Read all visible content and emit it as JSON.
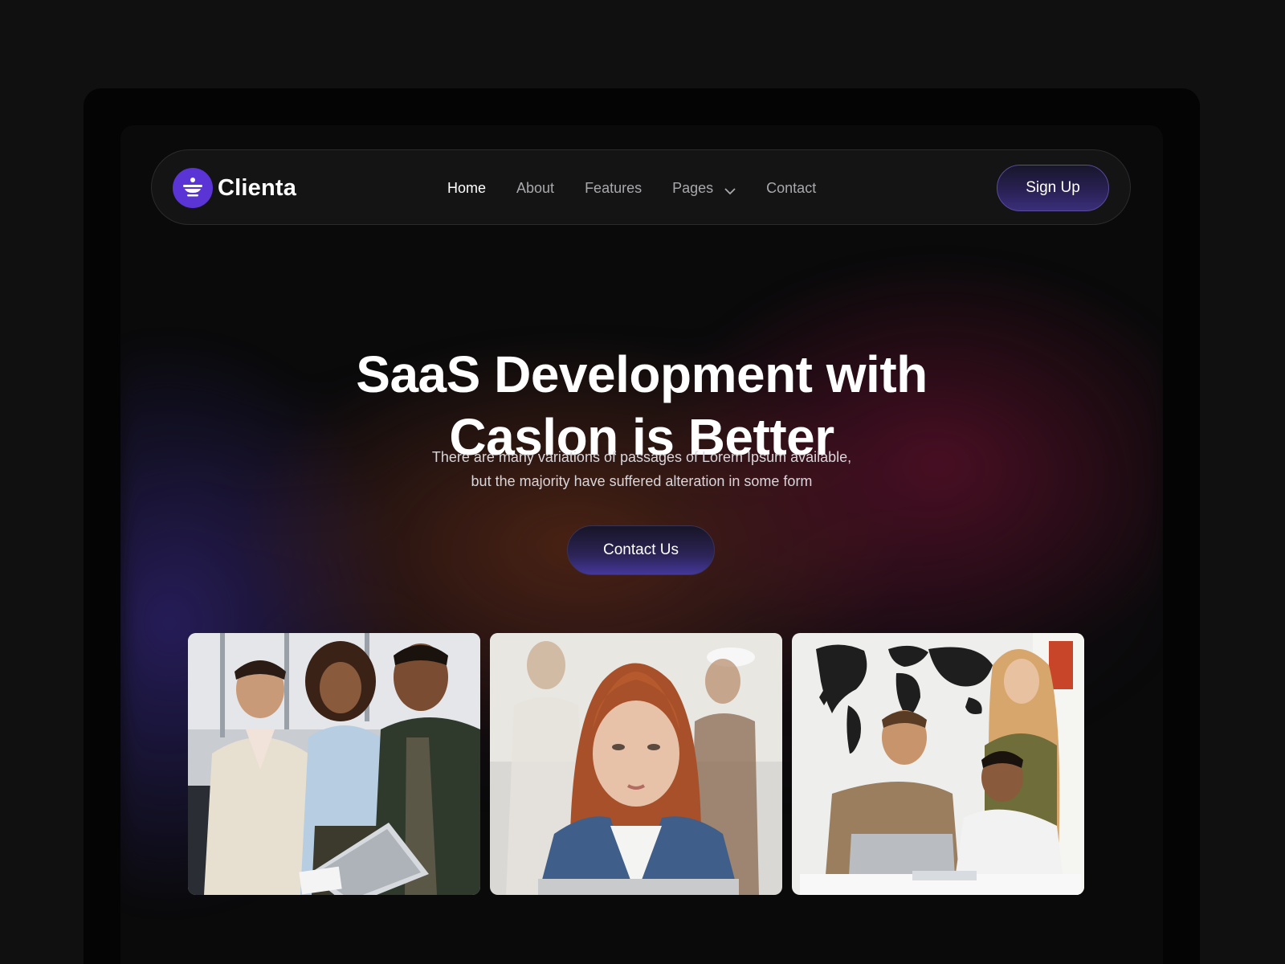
{
  "brand": {
    "name": "Clienta",
    "icon": "logo-icon",
    "accent_color": "#5b34d6"
  },
  "nav": {
    "items": [
      {
        "label": "Home",
        "active": true
      },
      {
        "label": "About",
        "active": false
      },
      {
        "label": "Features",
        "active": false
      },
      {
        "label": "Pages",
        "active": false,
        "has_dropdown": true
      },
      {
        "label": "Contact",
        "active": false
      }
    ],
    "signup_label": "Sign Up"
  },
  "hero": {
    "title_line1": "SaaS Development with",
    "title_line2": "Caslon is Better",
    "subtitle_line1": "There are many variations of passages of Lorem Ipsum available,",
    "subtitle_line2": "but the majority have suffered alteration in some form",
    "cta_label": "Contact Us"
  },
  "gallery": {
    "photos": [
      {
        "name": "team-with-tablet-photo"
      },
      {
        "name": "woman-working-photo"
      },
      {
        "name": "team-at-laptop-photo"
      }
    ]
  },
  "colors": {
    "background": "#0a0a0b",
    "button_gradient_end": "#43379a"
  }
}
